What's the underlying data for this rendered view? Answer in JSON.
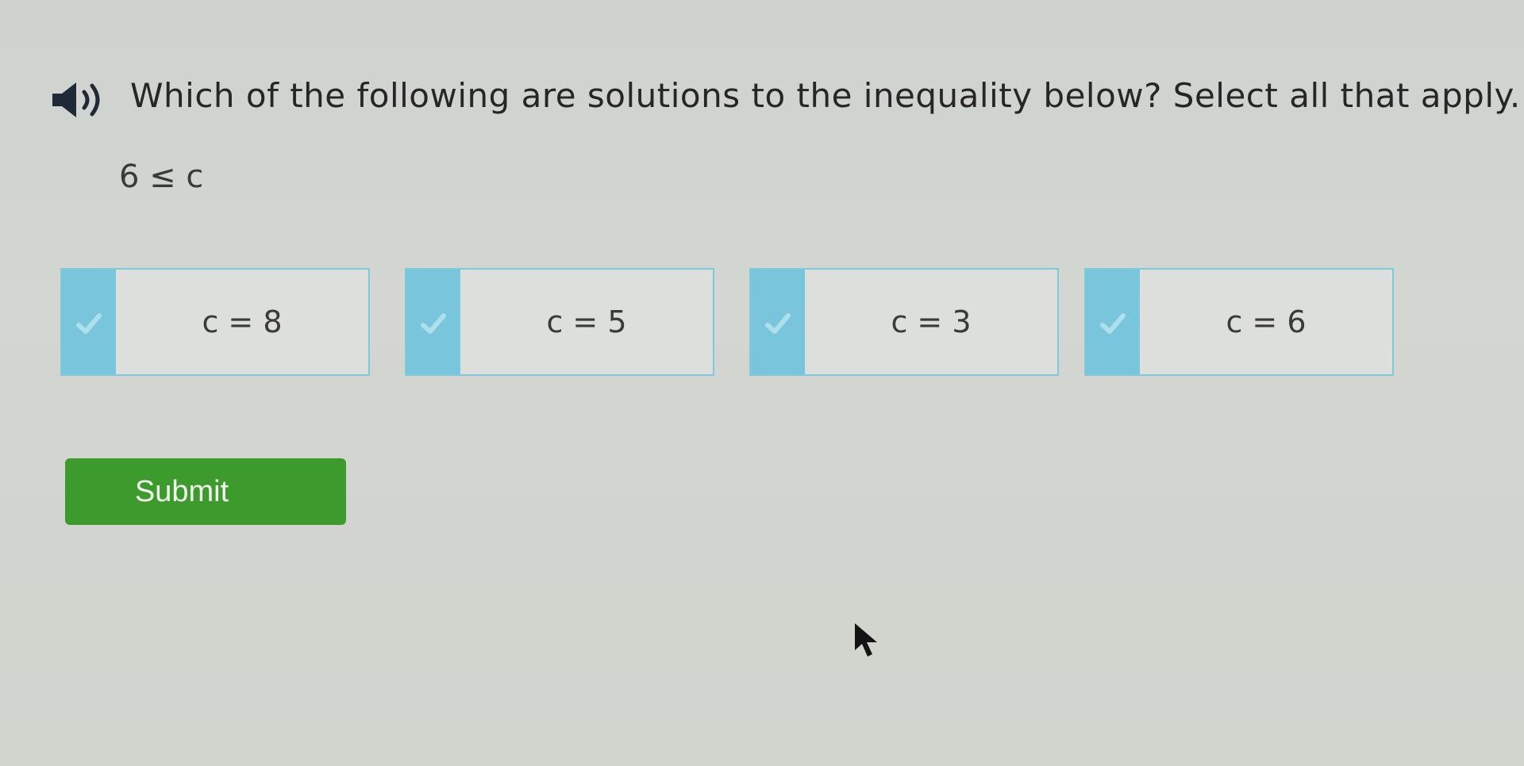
{
  "question": {
    "text": "Which of the following are solutions to the inequality below? Select all that apply.",
    "audio_icon": "speaker-icon"
  },
  "inequality": "6 ≤ c",
  "choices": [
    {
      "label": "c = 8",
      "icon": "checkmark-icon"
    },
    {
      "label": "c = 5",
      "icon": "checkmark-icon"
    },
    {
      "label": "c = 3",
      "icon": "checkmark-icon"
    },
    {
      "label": "c = 6",
      "icon": "checkmark-icon"
    }
  ],
  "submit": {
    "label": "Submit"
  },
  "colors": {
    "background": "#d2d5d0",
    "choice_accent": "#79c6dc",
    "submit": "#3d9a2c"
  }
}
